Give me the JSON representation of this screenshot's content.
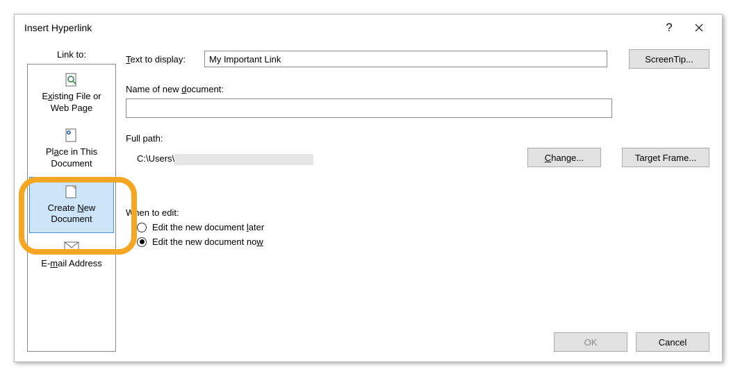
{
  "dialog": {
    "title": "Insert Hyperlink",
    "help": "?",
    "close": "Close"
  },
  "linkto": {
    "header": "Link to:",
    "items": [
      {
        "line1_pre": "E",
        "line1_u": "x",
        "line1_post": "isting File or",
        "line2": "Web Page"
      },
      {
        "line1_pre": "Pl",
        "line1_u": "a",
        "line1_post": "ce in This",
        "line2": "Document"
      },
      {
        "line1_pre": "Create ",
        "line1_u": "N",
        "line1_post": "ew",
        "line2": "Document"
      },
      {
        "line1_pre": "E-",
        "line1_u": "m",
        "line1_post": "ail Address",
        "line2": ""
      }
    ]
  },
  "text_display": {
    "label_pre": "",
    "label_u": "T",
    "label_post": "ext to display:",
    "value": "My Important Link"
  },
  "new_doc": {
    "label_pre": "Name of new ",
    "label_u": "d",
    "label_post": "ocument:",
    "value": ""
  },
  "fullpath": {
    "label": "Full path:",
    "prefix": "C:\\Users\\"
  },
  "buttons": {
    "screentip": "ScreenTip...",
    "change_pre": "",
    "change_u": "C",
    "change_post": "hange...",
    "target_frame": "Target Frame...",
    "ok": "OK",
    "cancel": "Cancel"
  },
  "when_edit": {
    "label": "When to edit:",
    "later_pre": "Edit the new document ",
    "later_u": "l",
    "later_post": "ater",
    "now_pre": "Edit the new document no",
    "now_u": "w",
    "now_post": ""
  }
}
